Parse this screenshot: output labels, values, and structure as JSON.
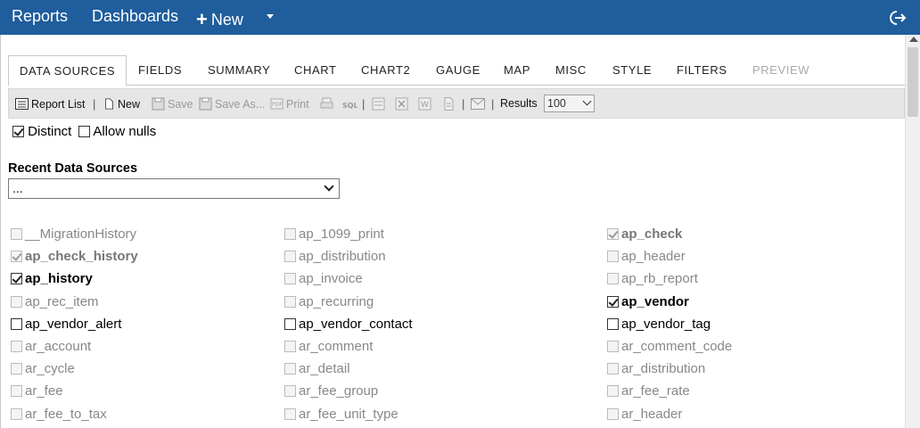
{
  "topbar": {
    "reports": "Reports",
    "dashboards": "Dashboards",
    "new_label": "New",
    "plus": "+"
  },
  "tabs": [
    {
      "label": "DATA SOURCES",
      "active": true
    },
    {
      "label": "FIELDS"
    },
    {
      "label": "SUMMARY"
    },
    {
      "label": "CHART"
    },
    {
      "label": "CHART2"
    },
    {
      "label": "GAUGE"
    },
    {
      "label": "MAP"
    },
    {
      "label": "MISC"
    },
    {
      "label": "STYLE"
    },
    {
      "label": "FILTERS"
    },
    {
      "label": "PREVIEW",
      "disabled": true
    }
  ],
  "toolbar": {
    "report_list": "Report List",
    "new": "New",
    "save": "Save",
    "save_as": "Save As...",
    "print": "Print",
    "results_label": "Results",
    "results_value": "100",
    "sep": "|"
  },
  "options": {
    "distinct": "Distinct",
    "allow_nulls": "Allow nulls"
  },
  "recent": {
    "title": "Recent Data Sources",
    "value": "..."
  },
  "datasources": [
    {
      "label": "__MigrationHistory",
      "checked": false,
      "disabled": true
    },
    {
      "label": "ap_1099_print",
      "checked": false,
      "disabled": true
    },
    {
      "label": "ap_check",
      "checked": true,
      "disabled": true,
      "bold": true
    },
    {
      "label": "ap_check_history",
      "checked": true,
      "disabled": true,
      "bold": true
    },
    {
      "label": "ap_distribution",
      "checked": false,
      "disabled": true
    },
    {
      "label": "ap_header",
      "checked": false,
      "disabled": true
    },
    {
      "label": "ap_history",
      "checked": true,
      "disabled": false,
      "bold": true
    },
    {
      "label": "ap_invoice",
      "checked": false,
      "disabled": true
    },
    {
      "label": "ap_rb_report",
      "checked": false,
      "disabled": true
    },
    {
      "label": "ap_rec_item",
      "checked": false,
      "disabled": true
    },
    {
      "label": "ap_recurring",
      "checked": false,
      "disabled": true
    },
    {
      "label": "ap_vendor",
      "checked": true,
      "disabled": false,
      "bold": true
    },
    {
      "label": "ap_vendor_alert",
      "checked": false,
      "disabled": false
    },
    {
      "label": "ap_vendor_contact",
      "checked": false,
      "disabled": false
    },
    {
      "label": "ap_vendor_tag",
      "checked": false,
      "disabled": false
    },
    {
      "label": "ar_account",
      "checked": false,
      "disabled": true
    },
    {
      "label": "ar_comment",
      "checked": false,
      "disabled": true
    },
    {
      "label": "ar_comment_code",
      "checked": false,
      "disabled": true
    },
    {
      "label": "ar_cycle",
      "checked": false,
      "disabled": true
    },
    {
      "label": "ar_detail",
      "checked": false,
      "disabled": true
    },
    {
      "label": "ar_distribution",
      "checked": false,
      "disabled": true
    },
    {
      "label": "ar_fee",
      "checked": false,
      "disabled": true
    },
    {
      "label": "ar_fee_group",
      "checked": false,
      "disabled": true
    },
    {
      "label": "ar_fee_rate",
      "checked": false,
      "disabled": true
    },
    {
      "label": "ar_fee_to_tax",
      "checked": false,
      "disabled": true
    },
    {
      "label": "ar_fee_unit_type",
      "checked": false,
      "disabled": true
    },
    {
      "label": "ar_header",
      "checked": false,
      "disabled": true
    }
  ],
  "colors": {
    "topbar": "#1f5d9c",
    "toolbar": "#e6e6e6"
  }
}
